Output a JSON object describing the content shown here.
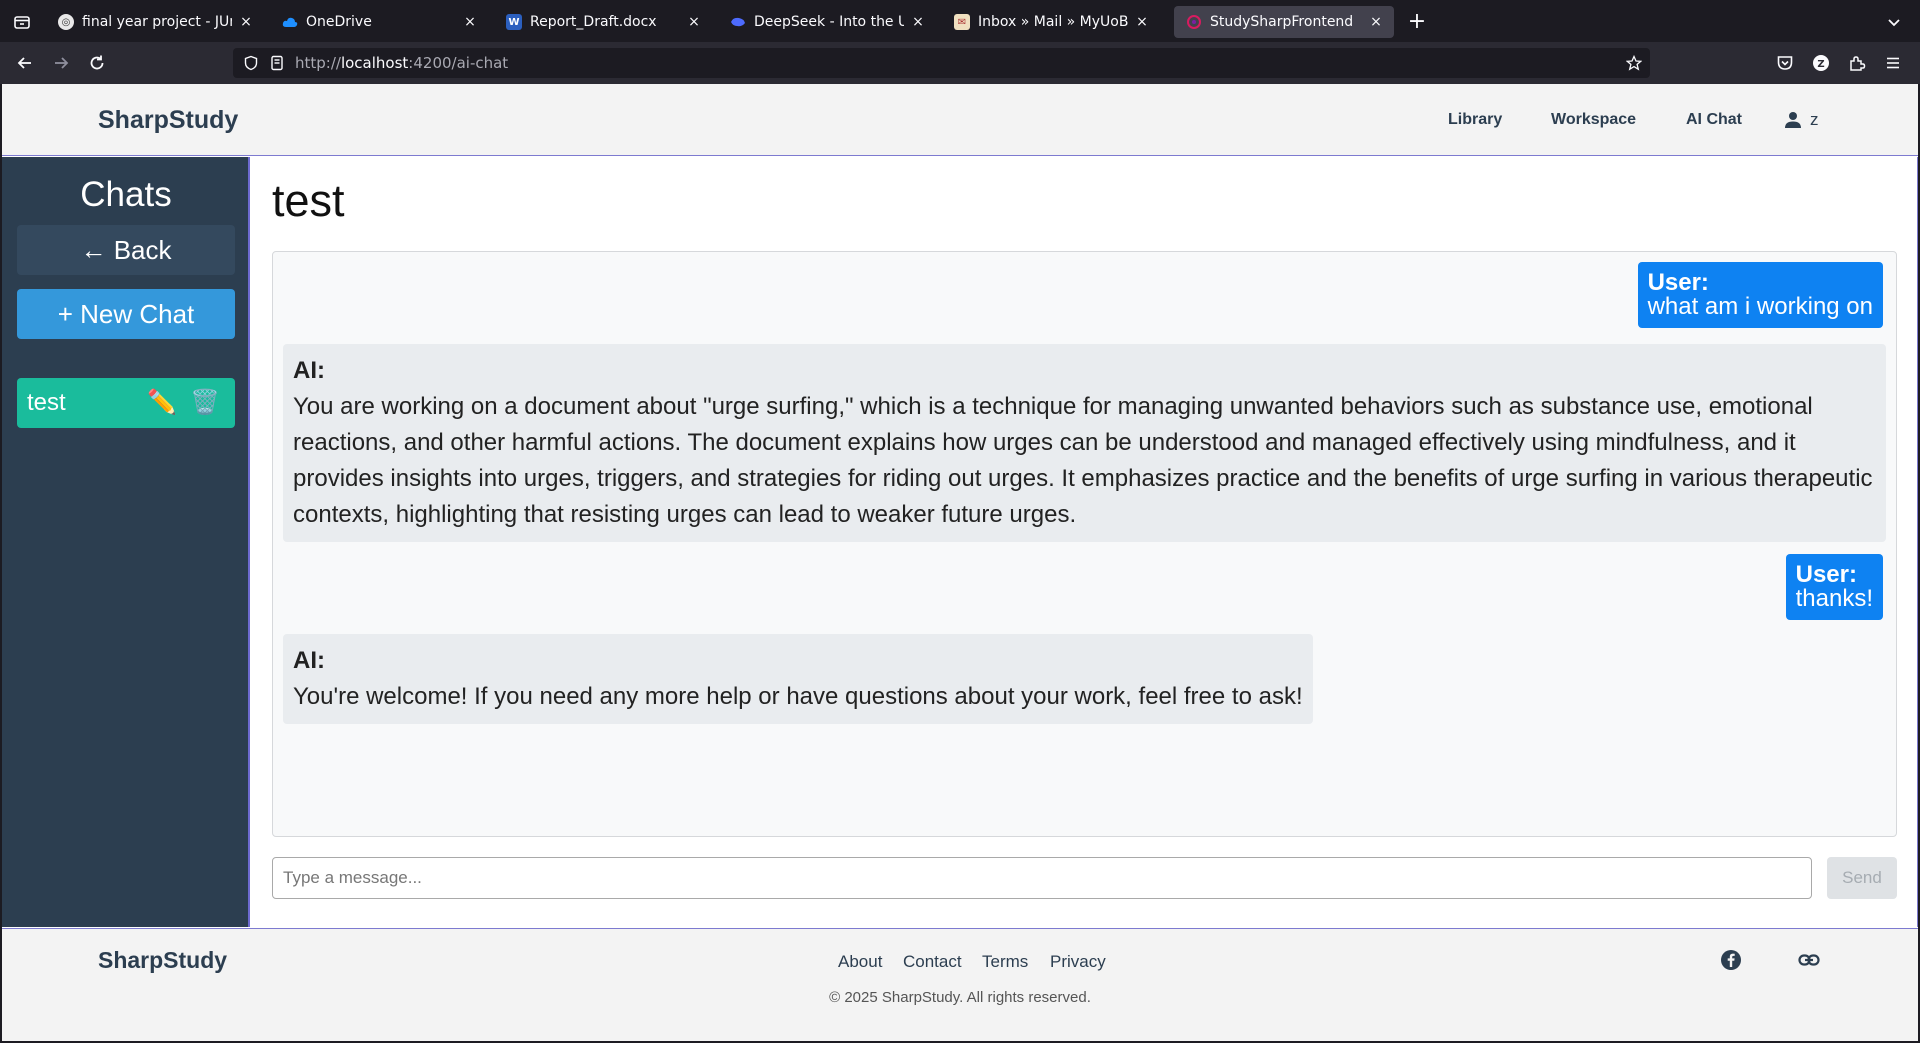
{
  "browser": {
    "tabs": [
      {
        "title": "final year project - JUni",
        "favicon_color": "#f5f5f5",
        "favicon_text": "◎"
      },
      {
        "title": "OneDrive",
        "favicon_color": "#0a64d8",
        "favicon_text": ""
      },
      {
        "title": "Report_Draft.docx",
        "favicon_color": "#2b5fbf",
        "favicon_text": "W"
      },
      {
        "title": "DeepSeek - Into the Unknown",
        "favicon_color": "#4d6bfe",
        "favicon_text": ""
      },
      {
        "title": "Inbox » Mail » MyUoB",
        "favicon_color": "#c0392b",
        "favicon_text": ""
      },
      {
        "title": "StudySharpFrontend",
        "favicon_color": "#c2185b",
        "favicon_text": ""
      }
    ],
    "close_glyph": "×",
    "new_tab_glyph": "+",
    "url_prefix": "http://",
    "url_host": "localhost",
    "url_path": ":4200/ai-chat"
  },
  "header": {
    "brand": "SharpStudy",
    "nav": [
      "Library",
      "Workspace",
      "AI Chat"
    ],
    "user": "z"
  },
  "sidebar": {
    "title": "Chats",
    "back_label": "← Back",
    "new_chat_label": "+ New Chat",
    "chats": [
      {
        "name": "test",
        "edit_icon": "✏️",
        "delete_icon": "🗑️"
      }
    ]
  },
  "chat": {
    "title": "test",
    "messages": [
      {
        "role": "user",
        "speaker": "User:",
        "text": "what am i working on"
      },
      {
        "role": "ai",
        "speaker": "AI:",
        "text": "You are working on a document about \"urge surfing,\" which is a technique for managing unwanted behaviors such as substance use, emotional reactions, and other harmful actions. The document explains how urges can be understood and managed effectively using mindfulness, and it provides insights into urges, triggers, and strategies for riding out urges. It emphasizes practice and the benefits of urge surfing in various therapeutic contexts, highlighting that resisting urges can lead to weaker future urges."
      },
      {
        "role": "user",
        "speaker": "User:",
        "text": "thanks!"
      },
      {
        "role": "ai",
        "speaker": "AI:",
        "text": "You're welcome! If you need any more help or have questions about your work, feel free to ask!"
      }
    ],
    "input_placeholder": "Type a message...",
    "send_label": "Send"
  },
  "footer": {
    "brand": "SharpStudy",
    "links": [
      "About",
      "Contact",
      "Terms",
      "Privacy"
    ],
    "copyright": "© 2025 SharpStudy. All rights reserved."
  }
}
